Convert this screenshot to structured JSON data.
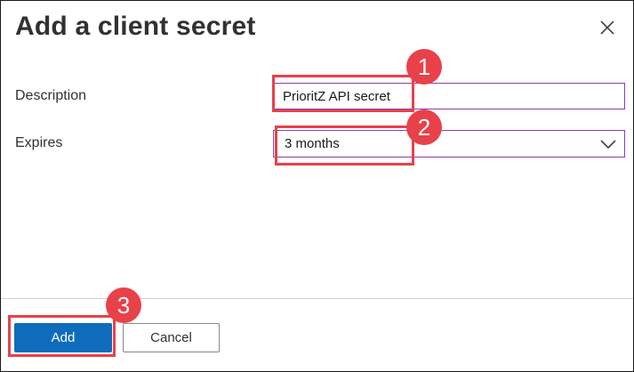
{
  "dialog": {
    "title": "Add a client secret",
    "close_icon": "close-icon"
  },
  "form": {
    "description_label": "Description",
    "description_value": "PrioritZ API secret",
    "expires_label": "Expires",
    "expires_value": "3 months",
    "expires_icon": "chevron-down-icon"
  },
  "callouts": [
    "1",
    "2",
    "3"
  ],
  "footer": {
    "add_label": "Add",
    "cancel_label": "Cancel"
  },
  "colors": {
    "accent": "#0f6cbd",
    "callout": "#e8414a",
    "focus_border": "#8a3fb0"
  }
}
